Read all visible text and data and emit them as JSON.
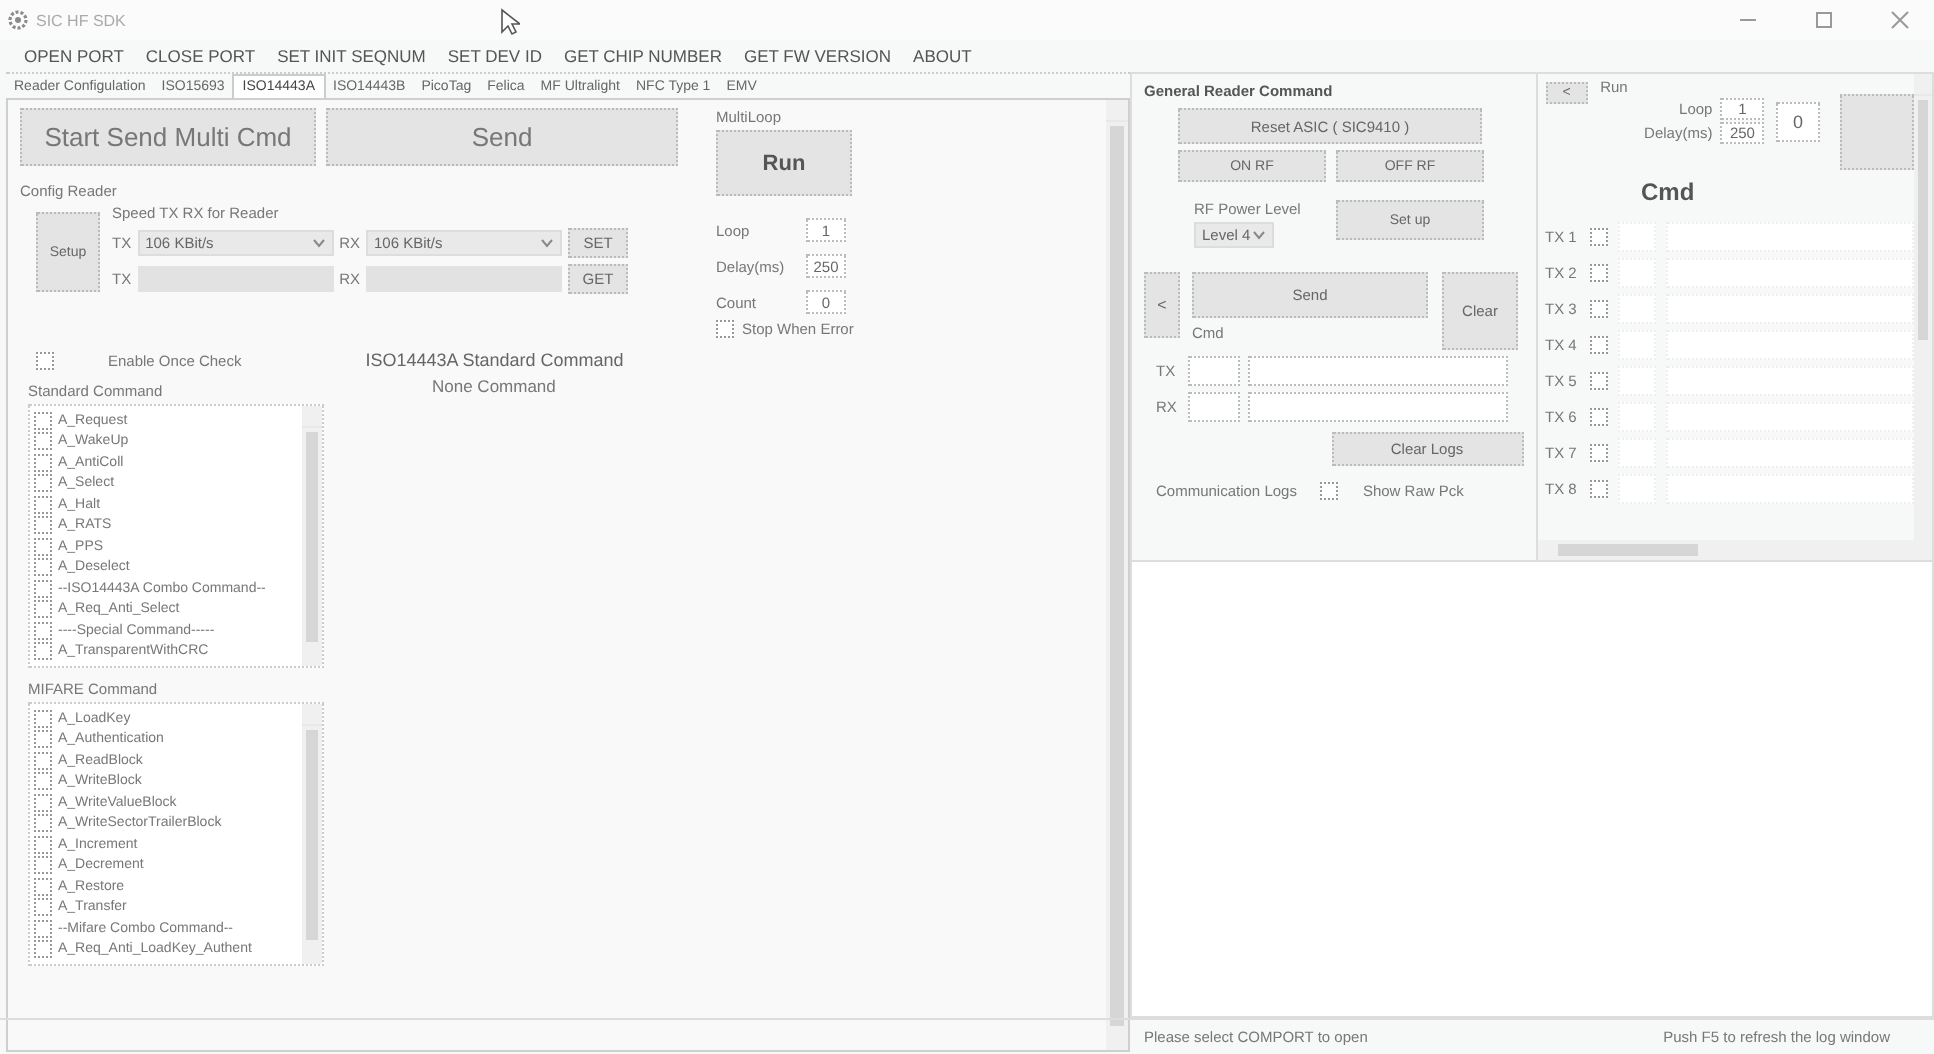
{
  "window": {
    "title": "SIC HF SDK"
  },
  "menu": [
    "OPEN PORT",
    "CLOSE PORT",
    "SET INIT SEQNUM",
    "SET DEV ID",
    "GET CHIP NUMBER",
    "GET FW VERSION",
    "ABOUT"
  ],
  "tabs": [
    {
      "label": "Reader Configulation",
      "selected": false
    },
    {
      "label": "ISO15693",
      "selected": false
    },
    {
      "label": "ISO14443A",
      "selected": true
    },
    {
      "label": "ISO14443B",
      "selected": false
    },
    {
      "label": "PicoTag",
      "selected": false
    },
    {
      "label": "Felica",
      "selected": false
    },
    {
      "label": "MF Ultralight",
      "selected": false
    },
    {
      "label": "NFC Type 1",
      "selected": false
    },
    {
      "label": "EMV",
      "selected": false
    }
  ],
  "multi_cmd": {
    "start": "Start Send Multi Cmd",
    "send": "Send"
  },
  "config_reader": {
    "title": "Config Reader",
    "speed_label": "Speed TX RX for Reader",
    "setup": "Setup",
    "rows": [
      {
        "tx_label": "TX",
        "tx_value": "106 KBit/s",
        "rx_label": "RX",
        "rx_value": "106 KBit/s",
        "button": "SET",
        "disabled": false
      },
      {
        "tx_label": "TX",
        "rx_label": "RX",
        "button": "GET",
        "disabled": true
      }
    ]
  },
  "multiloop": {
    "title": "MultiLoop",
    "run": "Run",
    "fields": [
      {
        "label": "Loop",
        "value": "1"
      },
      {
        "label": "Delay(ms)",
        "value": "250"
      },
      {
        "label": "Count",
        "value": "0"
      }
    ],
    "stop_when_error": {
      "label": "Stop When Error",
      "checked": false
    }
  },
  "enable_once_check": {
    "label": "Enable Once Check",
    "checked": false
  },
  "section_title": "ISO14443A Standard Command",
  "none_command": "None Command",
  "standard_command": {
    "title": "Standard Command",
    "items": [
      {
        "label": "A_Request",
        "checked": false
      },
      {
        "label": "A_WakeUp",
        "checked": false
      },
      {
        "label": "A_AntiColl",
        "checked": false
      },
      {
        "label": "A_Select",
        "checked": false
      },
      {
        "label": "A_Halt",
        "checked": false
      },
      {
        "label": "A_RATS",
        "checked": false
      },
      {
        "label": "A_PPS",
        "checked": false
      },
      {
        "label": "A_Deselect",
        "checked": false
      },
      {
        "label": "--ISO14443A Combo Command--",
        "checked": false
      },
      {
        "label": "A_Req_Anti_Select",
        "checked": false
      },
      {
        "label": "----Special Command-----",
        "checked": false
      },
      {
        "label": "A_TransparentWithCRC",
        "checked": false
      }
    ]
  },
  "mifare_command": {
    "title": "MIFARE Command",
    "items": [
      {
        "label": "A_LoadKey",
        "checked": false
      },
      {
        "label": "A_Authentication",
        "checked": false
      },
      {
        "label": "A_ReadBlock",
        "checked": false
      },
      {
        "label": "A_WriteBlock",
        "checked": false
      },
      {
        "label": "A_WriteValueBlock",
        "checked": false
      },
      {
        "label": "A_WriteSectorTrailerBlock",
        "checked": false
      },
      {
        "label": "A_Increment",
        "checked": false
      },
      {
        "label": "A_Decrement",
        "checked": false
      },
      {
        "label": "A_Restore",
        "checked": false
      },
      {
        "label": "A_Transfer",
        "checked": false
      },
      {
        "label": "--Mifare Combo Command--",
        "checked": false
      },
      {
        "label": "A_Req_Anti_LoadKey_Authent",
        "checked": false
      }
    ]
  },
  "general": {
    "title": "General Reader Command",
    "reset": "Reset ASIC ( SIC9410 )",
    "on_rf": "ON RF",
    "off_rf": "OFF RF",
    "power_label": "RF Power Level",
    "power_value": "Level 4",
    "setup": "Set up",
    "prev": "<",
    "send": "Send",
    "clear": "Clear",
    "cmd_label": "Cmd",
    "tx_label": "TX",
    "rx_label": "RX",
    "clear_logs": "Clear Logs",
    "comm_logs": "Communication Logs",
    "raw": {
      "label": "Show Raw Pck",
      "checked": false
    }
  },
  "multi_panel": {
    "prev": "<",
    "run_label": "Run",
    "loop": {
      "label": "Loop",
      "value": "1"
    },
    "delay": {
      "label": "Delay(ms)",
      "value": "250"
    },
    "count": "0",
    "cmd_title": "Cmd",
    "rows": [
      {
        "label": "TX 1",
        "checked": false
      },
      {
        "label": "TX 2",
        "checked": false
      },
      {
        "label": "TX 3",
        "checked": false
      },
      {
        "label": "TX 4",
        "checked": false
      },
      {
        "label": "TX 5",
        "checked": false
      },
      {
        "label": "TX 6",
        "checked": false
      },
      {
        "label": "TX 7",
        "checked": false
      },
      {
        "label": "TX 8",
        "checked": false
      }
    ]
  },
  "status_bar": {
    "left": "Please select COMPORT to open",
    "right": "Push F5 to refresh the log window"
  }
}
